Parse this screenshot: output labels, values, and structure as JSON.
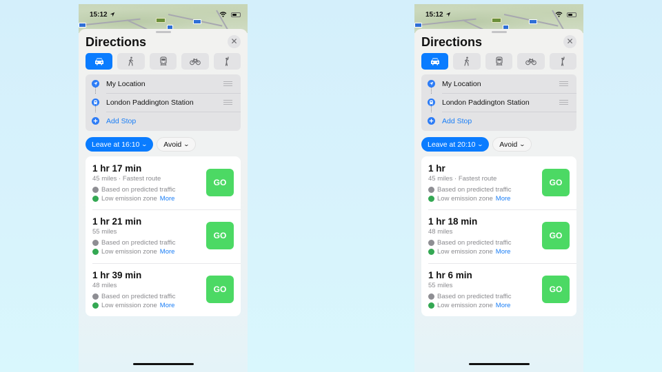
{
  "colors": {
    "accent": "#0a7cff",
    "go": "#4cd964",
    "link": "#1a7ef6",
    "traffic_icon": "#8e8e93",
    "emission_icon": "#34a853"
  },
  "phones": [
    {
      "status": {
        "time": "15:12",
        "location_icon": "location-arrow-icon"
      },
      "title": "Directions",
      "close_icon": "✕",
      "modes": [
        {
          "name": "drive",
          "icon": "car-icon",
          "active": true
        },
        {
          "name": "walk",
          "icon": "walk-icon",
          "active": false
        },
        {
          "name": "transit",
          "icon": "train-icon",
          "active": false
        },
        {
          "name": "cycle",
          "icon": "bike-icon",
          "active": false
        },
        {
          "name": "ride",
          "icon": "person-hail-icon",
          "active": false
        }
      ],
      "stops": {
        "origin": "My Location",
        "destination": "London Paddington Station",
        "add_stop": "Add Stop"
      },
      "leave_label": "Leave at 16:10",
      "avoid_label": "Avoid",
      "routes": [
        {
          "duration": "1 hr 17 min",
          "detail": "45 miles · Fastest route",
          "traffic": "Based on predicted traffic",
          "emission": "Low emission zone",
          "more": "More",
          "go": "GO"
        },
        {
          "duration": "1 hr 21 min",
          "detail": "55 miles",
          "traffic": "Based on predicted traffic",
          "emission": "Low emission zone",
          "more": "More",
          "go": "GO"
        },
        {
          "duration": "1 hr 39 min",
          "detail": "48 miles",
          "traffic": "Based on predicted traffic",
          "emission": "Low emission zone",
          "more": "More",
          "go": "GO"
        }
      ]
    },
    {
      "status": {
        "time": "15:12",
        "location_icon": "location-arrow-icon"
      },
      "title": "Directions",
      "close_icon": "✕",
      "modes": [
        {
          "name": "drive",
          "icon": "car-icon",
          "active": true
        },
        {
          "name": "walk",
          "icon": "walk-icon",
          "active": false
        },
        {
          "name": "transit",
          "icon": "train-icon",
          "active": false
        },
        {
          "name": "cycle",
          "icon": "bike-icon",
          "active": false
        },
        {
          "name": "ride",
          "icon": "person-hail-icon",
          "active": false
        }
      ],
      "stops": {
        "origin": "My Location",
        "destination": "London Paddington Station",
        "add_stop": "Add Stop"
      },
      "leave_label": "Leave at 20:10",
      "avoid_label": "Avoid",
      "routes": [
        {
          "duration": "1 hr",
          "detail": "45 miles · Fastest route",
          "traffic": "Based on predicted traffic",
          "emission": "Low emission zone",
          "more": "More",
          "go": "GO"
        },
        {
          "duration": "1 hr 18 min",
          "detail": "48 miles",
          "traffic": "Based on predicted traffic",
          "emission": "Low emission zone",
          "more": "More",
          "go": "GO"
        },
        {
          "duration": "1 hr 6 min",
          "detail": "55 miles",
          "traffic": "Based on predicted traffic",
          "emission": "Low emission zone",
          "more": "More",
          "go": "GO"
        }
      ]
    }
  ]
}
